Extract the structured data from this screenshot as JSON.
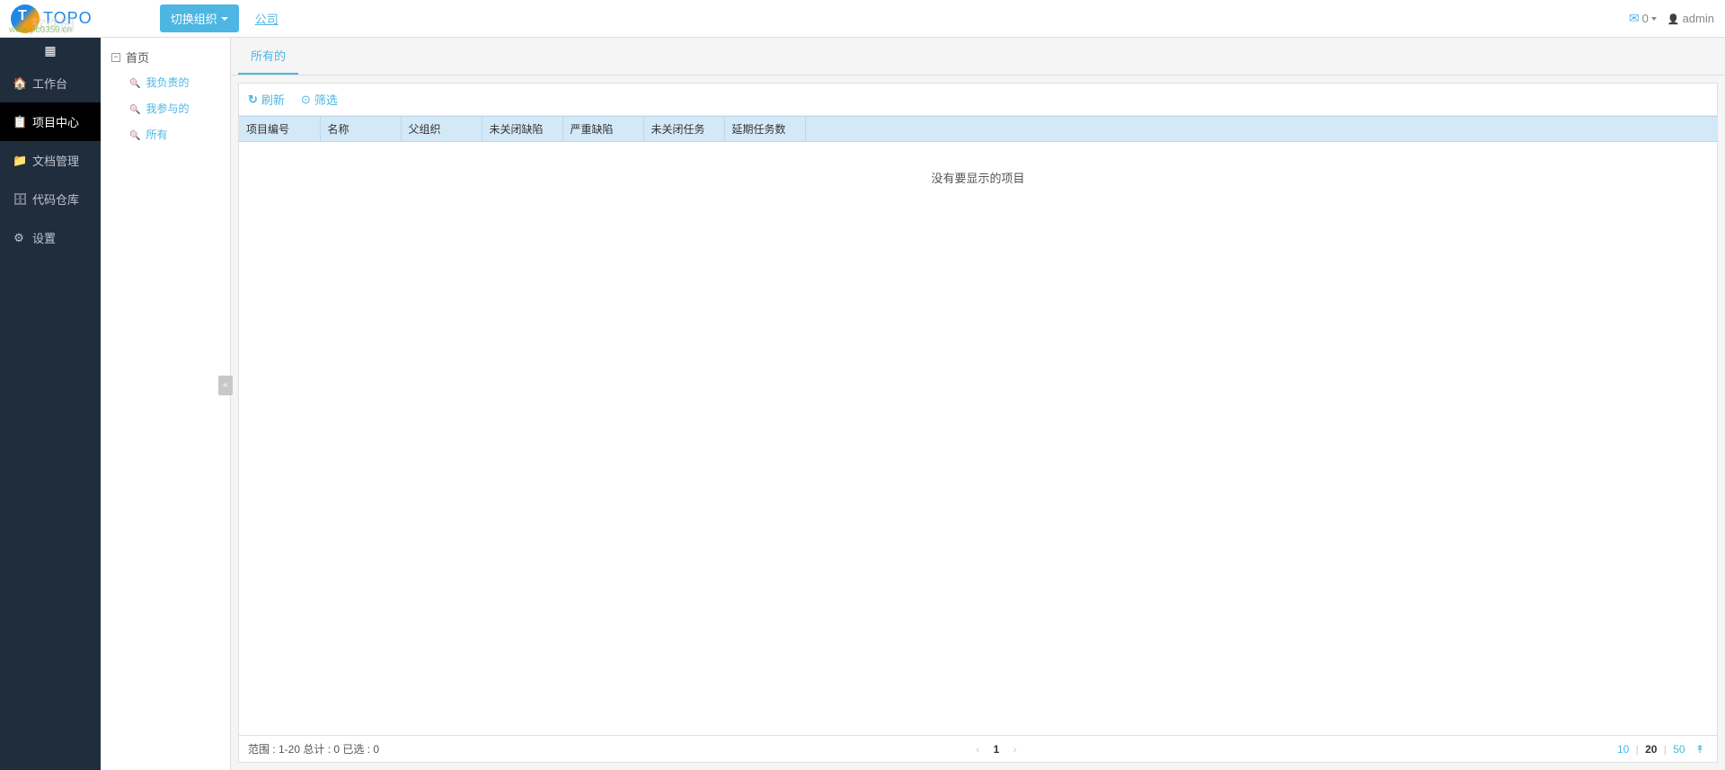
{
  "header": {
    "logo_text": "TOPO",
    "watermark": "软件园",
    "watermark_sub": "www.pc0359.cn",
    "org_dropdown": "切换组织",
    "company_link": "公司",
    "mail_count": "0",
    "username": "admin"
  },
  "sidebar": {
    "items": [
      {
        "icon": "🏠",
        "label": "工作台"
      },
      {
        "icon": "📋",
        "label": "项目中心"
      },
      {
        "icon": "📁",
        "label": "文档管理"
      },
      {
        "icon": "🗄",
        "label": "代码仓库"
      },
      {
        "icon": "⚙",
        "label": "设置"
      }
    ],
    "active_index": 1
  },
  "tree": {
    "root": "首页",
    "items": [
      {
        "label": "我负责的"
      },
      {
        "label": "我参与的"
      },
      {
        "label": "所有"
      }
    ]
  },
  "tabs": {
    "active": "所有的"
  },
  "toolbar": {
    "refresh": "刷新",
    "filter": "筛选"
  },
  "table": {
    "columns": [
      "项目编号",
      "名称",
      "父组织",
      "未关闭缺陷",
      "严重缺陷",
      "未关闭任务",
      "延期任务数"
    ],
    "empty_message": "没有要显示的项目"
  },
  "footer": {
    "range_text": "范围 : 1-20 总计 : 0 已选 : 0",
    "current_page": "1",
    "page_sizes": [
      "10",
      "20",
      "50"
    ],
    "active_size": "20"
  }
}
